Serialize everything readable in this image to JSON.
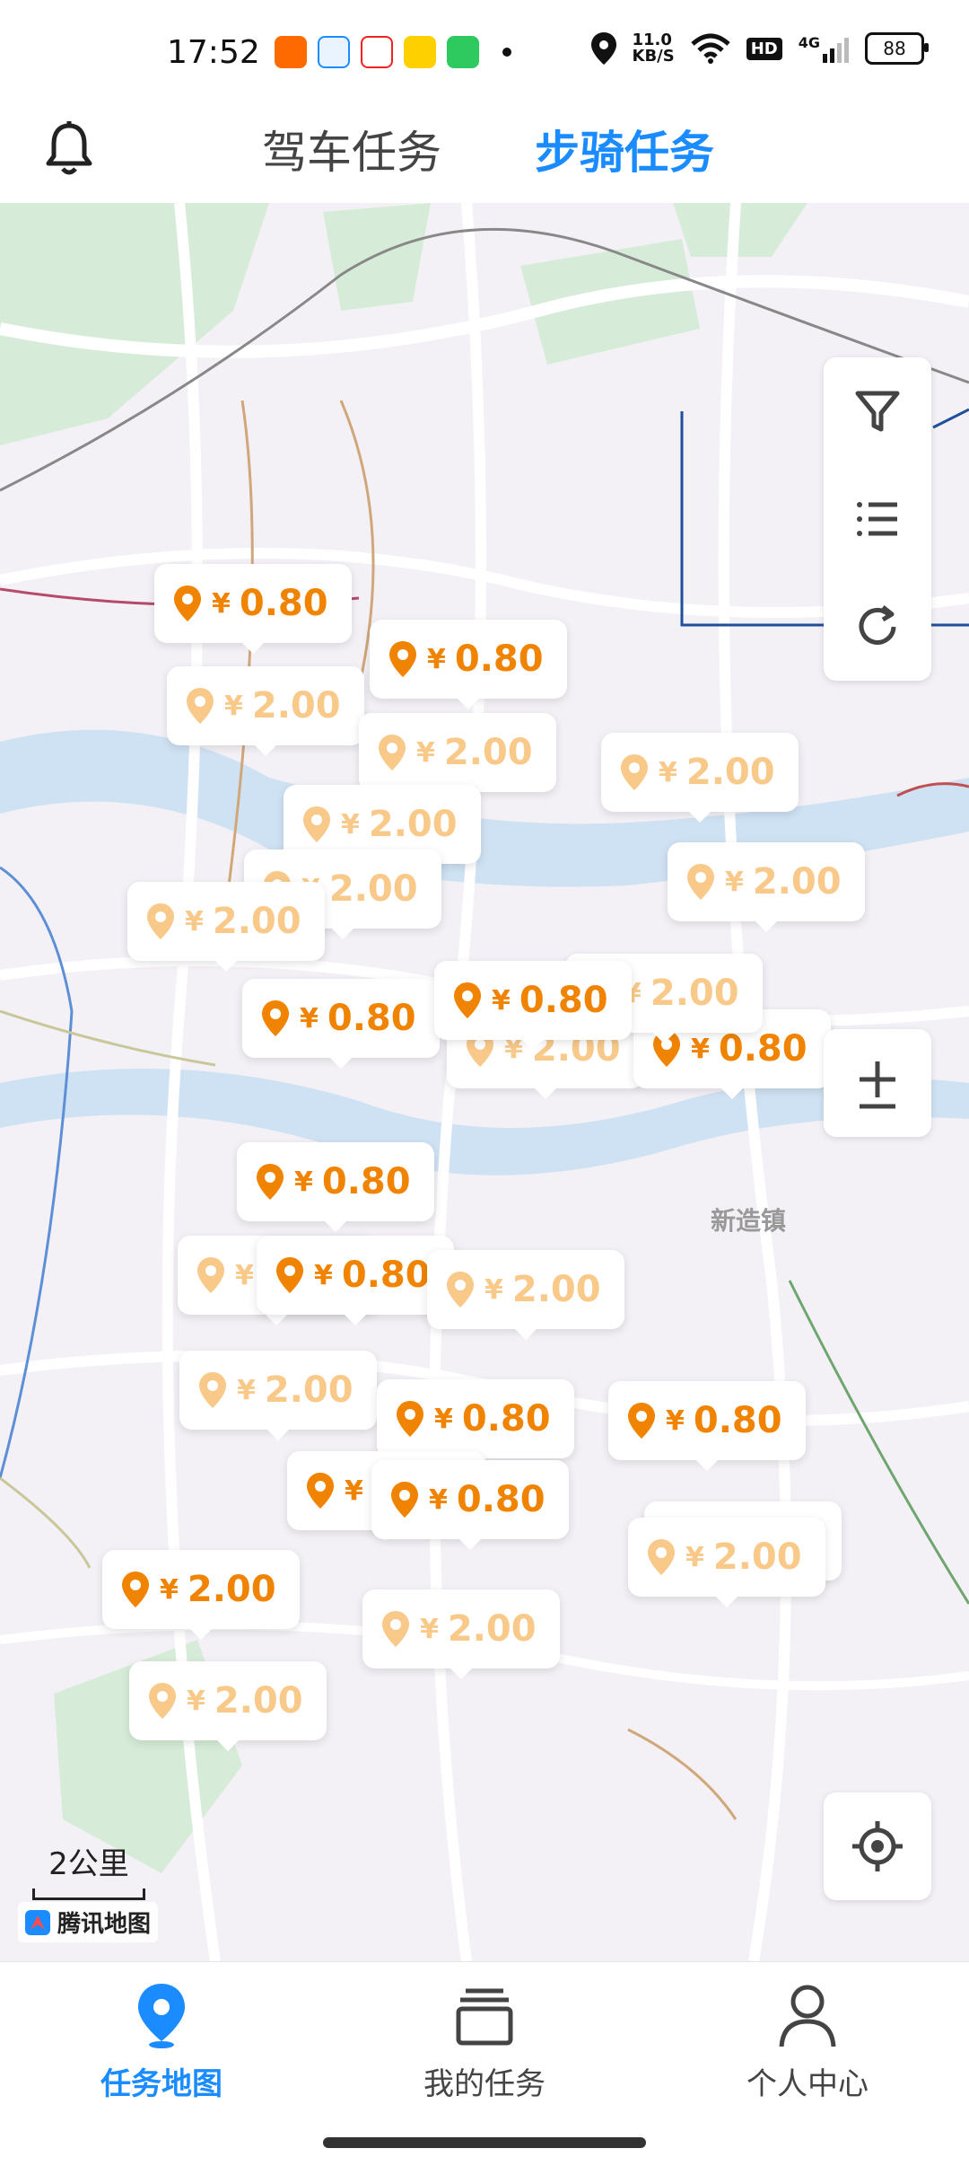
{
  "status_bar": {
    "time": "17:52",
    "network_speed": "11.0\nKB/S",
    "hd_label": "HD",
    "signal_label": "4G",
    "battery_level": "88",
    "icons": [
      "taobao-app-icon",
      "qq-browser-icon",
      "stock-app-icon",
      "meituan-app-icon",
      "wechat-icon",
      "dot-icon",
      "location-icon",
      "wifi-icon",
      "signal-icon",
      "battery-icon"
    ]
  },
  "header": {
    "tabs": [
      {
        "label": "驾车任务",
        "active": false
      },
      {
        "label": "步骑任务",
        "active": true
      }
    ],
    "accent_color": "#1a8cff"
  },
  "map": {
    "scale_label": "2公里",
    "provider_label": "腾讯地图",
    "place_label": "新造镇",
    "pins": [
      {
        "price": "0.80",
        "strong": true
      },
      {
        "price": "0.80",
        "strong": true
      },
      {
        "price": "2.00",
        "strong": false
      },
      {
        "price": "2.00",
        "strong": false
      },
      {
        "price": "2.00",
        "strong": false
      },
      {
        "price": "2.00",
        "strong": false
      },
      {
        "price": "2.00",
        "strong": false
      },
      {
        "price": "2.00",
        "strong": false
      },
      {
        "price": "2.00",
        "strong": false
      },
      {
        "price": "0.80",
        "strong": true
      },
      {
        "price": "2.00",
        "strong": false
      },
      {
        "price": "0.80",
        "strong": true
      },
      {
        "price": "2.00",
        "strong": false
      },
      {
        "price": "0.80",
        "strong": true
      },
      {
        "price": "0.80",
        "strong": true
      },
      {
        "price": "2.00",
        "strong": false
      },
      {
        "price": "0.80",
        "strong": true
      },
      {
        "price": "2.00",
        "strong": false
      },
      {
        "price": "2.00",
        "strong": false
      },
      {
        "price": "0.80",
        "strong": true
      },
      {
        "price": "0.80",
        "strong": true
      },
      {
        "price": "0.80",
        "strong": true
      },
      {
        "price": "0.80",
        "strong": true
      },
      {
        "price": "2.00",
        "strong": false
      },
      {
        "price": "2.00",
        "strong": false
      },
      {
        "price": "2.00",
        "strong": true
      },
      {
        "price": "2.00",
        "strong": false
      },
      {
        "price": "2.00",
        "strong": false
      }
    ],
    "currency": "¥",
    "pin_color_strong": "#f08300",
    "pin_color_faded": "#f9c98a"
  },
  "map_controls": {
    "icons": [
      "filter-icon",
      "list-icon",
      "refresh-icon",
      "zoom-icon",
      "locate-icon"
    ]
  },
  "bottom_nav": {
    "items": [
      {
        "label": "任务地图",
        "active": true
      },
      {
        "label": "我的任务",
        "active": false
      },
      {
        "label": "个人中心",
        "active": false
      }
    ]
  }
}
